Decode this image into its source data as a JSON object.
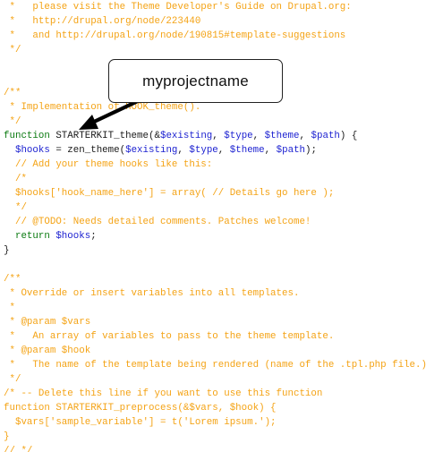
{
  "code_lines": [
    {
      "parts": [
        {
          "t": " *   please visit the Theme Developer's Guide on Drupal.org:",
          "cls": "c"
        }
      ]
    },
    {
      "parts": [
        {
          "t": " *   http://drupal.org/node/223440",
          "cls": "c"
        }
      ]
    },
    {
      "parts": [
        {
          "t": " *   and http://drupal.org/node/190815#template-suggestions",
          "cls": "c"
        }
      ]
    },
    {
      "parts": [
        {
          "t": " */",
          "cls": "c"
        }
      ]
    },
    {
      "parts": []
    },
    {
      "parts": []
    },
    {
      "parts": [
        {
          "t": "/**",
          "cls": "c"
        }
      ]
    },
    {
      "parts": [
        {
          "t": " * Implementation of HOOK_theme().",
          "cls": "c"
        }
      ]
    },
    {
      "parts": [
        {
          "t": " */",
          "cls": "c"
        }
      ]
    },
    {
      "parts": [
        {
          "t": "function ",
          "cls": "k"
        },
        {
          "t": "STARTERKIT_theme(&",
          "cls": "b"
        },
        {
          "t": "$existing",
          "cls": "v"
        },
        {
          "t": ", ",
          "cls": "b"
        },
        {
          "t": "$type",
          "cls": "v"
        },
        {
          "t": ", ",
          "cls": "b"
        },
        {
          "t": "$theme",
          "cls": "v"
        },
        {
          "t": ", ",
          "cls": "b"
        },
        {
          "t": "$path",
          "cls": "v"
        },
        {
          "t": ") {",
          "cls": "b"
        }
      ]
    },
    {
      "parts": [
        {
          "t": "  ",
          "cls": "b"
        },
        {
          "t": "$hooks",
          "cls": "v"
        },
        {
          "t": " = zen_theme(",
          "cls": "b"
        },
        {
          "t": "$existing",
          "cls": "v"
        },
        {
          "t": ", ",
          "cls": "b"
        },
        {
          "t": "$type",
          "cls": "v"
        },
        {
          "t": ", ",
          "cls": "b"
        },
        {
          "t": "$theme",
          "cls": "v"
        },
        {
          "t": ", ",
          "cls": "b"
        },
        {
          "t": "$path",
          "cls": "v"
        },
        {
          "t": ");",
          "cls": "b"
        }
      ]
    },
    {
      "parts": [
        {
          "t": "  // Add your theme hooks like this:",
          "cls": "c"
        }
      ]
    },
    {
      "parts": [
        {
          "t": "  /*",
          "cls": "c"
        }
      ]
    },
    {
      "parts": [
        {
          "t": "  $hooks['hook_name_here'] = array( // Details go here );",
          "cls": "c"
        }
      ]
    },
    {
      "parts": [
        {
          "t": "  */",
          "cls": "c"
        }
      ]
    },
    {
      "parts": [
        {
          "t": "  // @TODO: Needs detailed comments. Patches welcome!",
          "cls": "c"
        }
      ]
    },
    {
      "parts": [
        {
          "t": "  ",
          "cls": "b"
        },
        {
          "t": "return ",
          "cls": "k"
        },
        {
          "t": "$hooks",
          "cls": "v"
        },
        {
          "t": ";",
          "cls": "b"
        }
      ]
    },
    {
      "parts": [
        {
          "t": "}",
          "cls": "b"
        }
      ]
    },
    {
      "parts": []
    },
    {
      "parts": [
        {
          "t": "/**",
          "cls": "c"
        }
      ]
    },
    {
      "parts": [
        {
          "t": " * Override or insert variables into all templates.",
          "cls": "c"
        }
      ]
    },
    {
      "parts": [
        {
          "t": " *",
          "cls": "c"
        }
      ]
    },
    {
      "parts": [
        {
          "t": " * @param $vars",
          "cls": "c"
        }
      ]
    },
    {
      "parts": [
        {
          "t": " *   An array of variables to pass to the theme template.",
          "cls": "c"
        }
      ]
    },
    {
      "parts": [
        {
          "t": " * @param $hook",
          "cls": "c"
        }
      ]
    },
    {
      "parts": [
        {
          "t": " *   The name of the template being rendered (name of the .tpl.php file.)",
          "cls": "c"
        }
      ]
    },
    {
      "parts": [
        {
          "t": " */",
          "cls": "c"
        }
      ]
    },
    {
      "parts": [
        {
          "t": "/* -- Delete this line if you want to use this function",
          "cls": "c"
        }
      ]
    },
    {
      "parts": [
        {
          "t": "function STARTERKIT_preprocess(&$vars, $hook) {",
          "cls": "c"
        }
      ]
    },
    {
      "parts": [
        {
          "t": "  $vars['sample_variable'] = t('Lorem ipsum.');",
          "cls": "c"
        }
      ]
    },
    {
      "parts": [
        {
          "t": "}",
          "cls": "c"
        }
      ]
    },
    {
      "parts": [
        {
          "t": "// */",
          "cls": "c"
        }
      ]
    }
  ],
  "callout": {
    "label": "myprojectname"
  },
  "colors": {
    "comment": "#f4a315",
    "keyword": "#0a7a10",
    "variable": "#1a1fd0",
    "text": "#1a1a1a"
  }
}
